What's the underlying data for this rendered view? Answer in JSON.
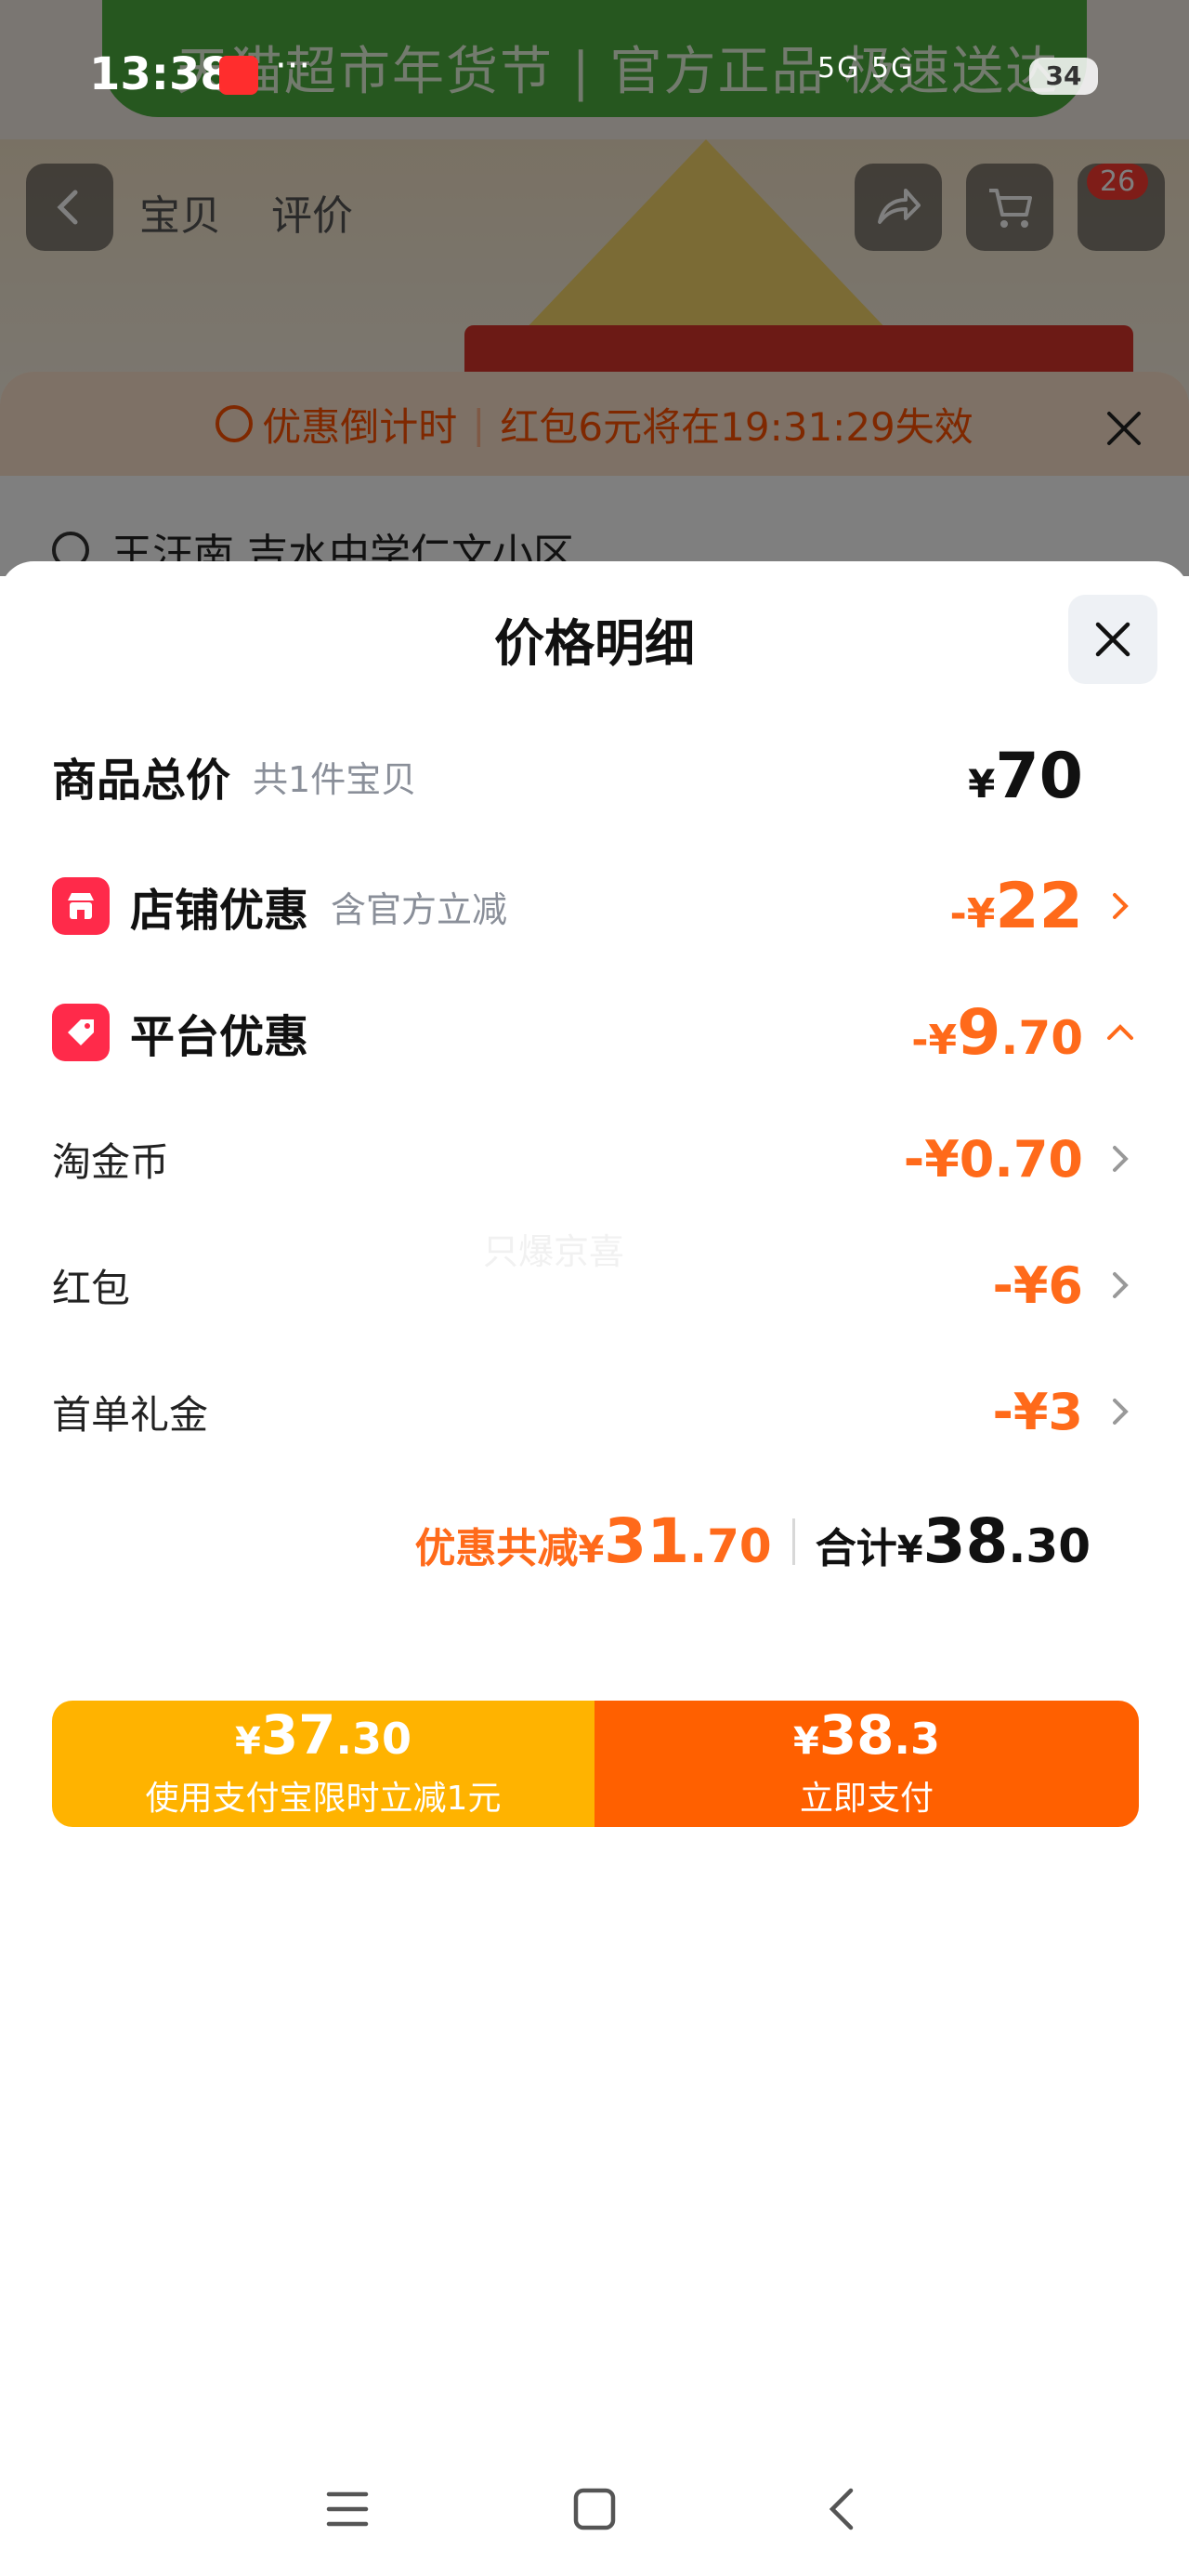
{
  "status_bar": {
    "time": "13:38",
    "dots": "···",
    "signal": "5G 5G",
    "battery": "34"
  },
  "background": {
    "banner_text": "天猫超市年货节 | 官方正品 极速送达",
    "tabs": [
      "宝贝",
      "评价"
    ],
    "cart_count": "26",
    "countdown_label": "优惠倒计时",
    "countdown_text": "红包6元将在19:31:29失效",
    "address": "王汪南 吉水中学仁文小区"
  },
  "sheet": {
    "title": "价格明细",
    "goods_total": {
      "label": "商品总价",
      "sub": "共1件宝贝",
      "currency": "¥",
      "value": "70"
    },
    "shop_discount": {
      "label": "店铺优惠",
      "sub": "含官方立减",
      "sign": "-¥",
      "value": "22"
    },
    "platform_discount": {
      "label": "平台优惠",
      "sign": "-¥",
      "value_int": "9",
      "value_dec": ".70"
    },
    "sub_items": [
      {
        "label": "淘金币",
        "amount": "-¥0.70"
      },
      {
        "label": "红包",
        "amount": "-¥6"
      },
      {
        "label": "首单礼金",
        "amount": "-¥3"
      }
    ],
    "watermark": "只爆京喜",
    "summary": {
      "discount_label": "优惠共减",
      "discount_currency": "¥",
      "discount_int": "31",
      "discount_dec": ".70",
      "total_label": "合计",
      "total_currency": "¥",
      "total_int": "38",
      "total_dec": ".30"
    }
  },
  "paybar": {
    "left": {
      "currency": "¥",
      "int": "37",
      "dec": ".30",
      "caption": "使用支付宝限时立减1元"
    },
    "right": {
      "currency": "¥",
      "int": "38",
      "dec": ".3",
      "caption": "立即支付"
    }
  },
  "colors": {
    "discount_orange": "#ff6a1a",
    "pay_yellow": "#ffb300",
    "pay_orange": "#ff6000",
    "badge_red": "#ff2a4a"
  },
  "icons": [
    "back-icon",
    "share-icon",
    "cart-icon",
    "clock-icon",
    "close-icon",
    "location-icon",
    "store-icon",
    "tag-icon",
    "chevron-right-icon",
    "chevron-up-icon",
    "menu-icon",
    "home-icon",
    "nav-back-icon"
  ]
}
